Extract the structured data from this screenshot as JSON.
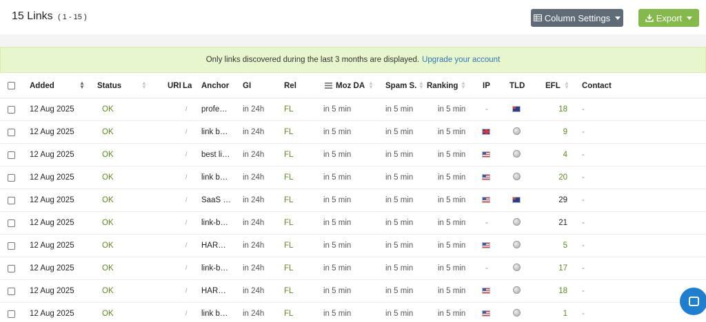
{
  "header": {
    "title": "15 Links",
    "range": "( 1 - 15 )",
    "column_settings_label": "Column Settings",
    "export_label": "Export"
  },
  "notice": {
    "text": "Only links discovered during the last 3 months are displayed.",
    "link": "Upgrade your account"
  },
  "table": {
    "headers": {
      "added": "Added",
      "status": "Status",
      "url": "URI",
      "lang": "La",
      "anchor": "Anchor",
      "gi": "GI",
      "rel": "Rel",
      "moz_da": "Moz DA",
      "spam": "Spam S.",
      "ranking": "Ranking",
      "ip": "IP",
      "tld": "TLD",
      "efl": "EFL",
      "contact": "Contact"
    },
    "rows": [
      {
        "added": "12 Aug 2025",
        "status": "OK",
        "url": "/",
        "anchor": "profe…",
        "gi": "in 24h",
        "rel": "FL",
        "moz": "in 5 min",
        "spam": "in 5 min",
        "ranking": "in 5 min",
        "ip": "-",
        "ip_flag": "",
        "tld": "au",
        "efl": "18",
        "efl_style": "green",
        "contact": "-"
      },
      {
        "added": "12 Aug 2025",
        "status": "OK",
        "url": "/",
        "anchor": "link b…",
        "gi": "in 24h",
        "rel": "FL",
        "moz": "in 5 min",
        "spam": "in 5 min",
        "ranking": "in 5 min",
        "ip": "",
        "ip_flag": "gb",
        "tld": "globe",
        "efl": "9",
        "efl_style": "green",
        "contact": "-"
      },
      {
        "added": "12 Aug 2025",
        "status": "OK",
        "url": "/",
        "anchor": "best li…",
        "gi": "in 24h",
        "rel": "FL",
        "moz": "in 5 min",
        "spam": "in 5 min",
        "ranking": "in 5 min",
        "ip": "",
        "ip_flag": "us",
        "tld": "globe",
        "efl": "4",
        "efl_style": "green",
        "contact": "-"
      },
      {
        "added": "12 Aug 2025",
        "status": "OK",
        "url": "/",
        "anchor": "link b…",
        "gi": "in 24h",
        "rel": "FL",
        "moz": "in 5 min",
        "spam": "in 5 min",
        "ranking": "in 5 min",
        "ip": "",
        "ip_flag": "us",
        "tld": "globe",
        "efl": "20",
        "efl_style": "green",
        "contact": "-"
      },
      {
        "added": "12 Aug 2025",
        "status": "OK",
        "url": "/",
        "anchor": "SaaS …",
        "gi": "in 24h",
        "rel": "FL",
        "moz": "in 5 min",
        "spam": "in 5 min",
        "ranking": "in 5 min",
        "ip": "",
        "ip_flag": "us",
        "tld": "au",
        "efl": "29",
        "efl_style": "dark",
        "contact": "-"
      },
      {
        "added": "12 Aug 2025",
        "status": "OK",
        "url": "/",
        "anchor": "link-b…",
        "gi": "in 24h",
        "rel": "FL",
        "moz": "in 5 min",
        "spam": "in 5 min",
        "ranking": "in 5 min",
        "ip": "-",
        "ip_flag": "",
        "tld": "globe",
        "efl": "21",
        "efl_style": "dark",
        "contact": "-"
      },
      {
        "added": "12 Aug 2025",
        "status": "OK",
        "url": "/",
        "anchor": "HAR…",
        "gi": "in 24h",
        "rel": "FL",
        "moz": "in 5 min",
        "spam": "in 5 min",
        "ranking": "in 5 min",
        "ip": "",
        "ip_flag": "us",
        "tld": "globe",
        "efl": "5",
        "efl_style": "green",
        "contact": "-"
      },
      {
        "added": "12 Aug 2025",
        "status": "OK",
        "url": "/",
        "anchor": "link-b…",
        "gi": "in 24h",
        "rel": "FL",
        "moz": "in 5 min",
        "spam": "in 5 min",
        "ranking": "in 5 min",
        "ip": "-",
        "ip_flag": "",
        "tld": "globe",
        "efl": "17",
        "efl_style": "green",
        "contact": "-"
      },
      {
        "added": "12 Aug 2025",
        "status": "OK",
        "url": "/",
        "anchor": "HAR…",
        "gi": "in 24h",
        "rel": "FL",
        "moz": "in 5 min",
        "spam": "in 5 min",
        "ranking": "in 5 min",
        "ip": "",
        "ip_flag": "us",
        "tld": "globe",
        "efl": "18",
        "efl_style": "green",
        "contact": "-"
      },
      {
        "added": "12 Aug 2025",
        "status": "OK",
        "url": "/",
        "anchor": "link b…",
        "gi": "in 24h",
        "rel": "FL",
        "moz": "in 5 min",
        "spam": "in 5 min",
        "ranking": "in 5 min",
        "ip": "",
        "ip_flag": "us",
        "tld": "globe",
        "efl": "1",
        "efl_style": "green",
        "contact": "-"
      }
    ]
  },
  "colors": {
    "accent_green": "#5a8a1e",
    "export_button": "#86b94c",
    "settings_button": "#5f6b76",
    "notice_bg": "#e8f6cd",
    "link_blue": "#2f74b5",
    "chat_blue": "#1f7ecd"
  },
  "icons": {
    "column_settings": "table-icon",
    "export": "download-icon",
    "chat": "chat-icon"
  }
}
